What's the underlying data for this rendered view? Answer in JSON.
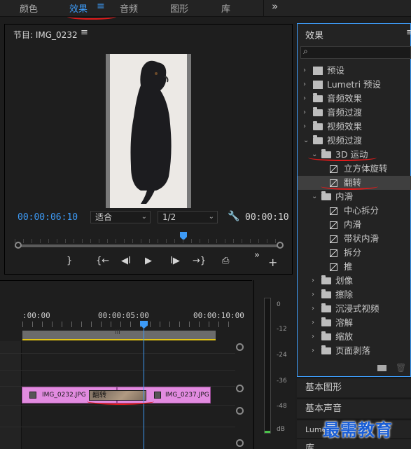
{
  "workspaces": {
    "tabs": [
      "颜色",
      "效果",
      "音频",
      "图形",
      "库"
    ],
    "active": "效果",
    "more_label": "»"
  },
  "program": {
    "title": "节目: IMG_0232",
    "menu_label": "≡",
    "timecode_current": "00:00:06:10",
    "zoom_value": "适合",
    "resolution_value": "1/2",
    "timecode_duration": "00:00:10",
    "controls": {
      "mark_in": "{",
      "mark_out": "}",
      "go_in": "{←",
      "step_back": "◀I",
      "play": "▶",
      "step_forward": "I▶",
      "go_out": "→}",
      "export_frame": "⎙",
      "more": "»",
      "add": "+"
    }
  },
  "effects": {
    "title": "效果",
    "menu_label": "≡",
    "search_placeholder": "",
    "tree": [
      {
        "label": "预设",
        "type": "preset",
        "level": 0,
        "expanded": false
      },
      {
        "label": "Lumetri 预设",
        "type": "preset",
        "level": 0,
        "expanded": false
      },
      {
        "label": "音频效果",
        "type": "folder",
        "level": 0,
        "expanded": false
      },
      {
        "label": "音频过渡",
        "type": "folder",
        "level": 0,
        "expanded": false
      },
      {
        "label": "视频效果",
        "type": "folder",
        "level": 0,
        "expanded": false
      },
      {
        "label": "视频过渡",
        "type": "folder",
        "level": 0,
        "expanded": true
      },
      {
        "label": "3D 运动",
        "type": "folder",
        "level": 1,
        "expanded": true
      },
      {
        "label": "立方体旋转",
        "type": "effect",
        "level": 2
      },
      {
        "label": "翻转",
        "type": "effect",
        "level": 2,
        "selected": true
      },
      {
        "label": "内滑",
        "type": "folder",
        "level": 1,
        "expanded": true
      },
      {
        "label": "中心拆分",
        "type": "effect",
        "level": 2
      },
      {
        "label": "内滑",
        "type": "effect",
        "level": 2
      },
      {
        "label": "带状内滑",
        "type": "effect",
        "level": 2
      },
      {
        "label": "拆分",
        "type": "effect",
        "level": 2
      },
      {
        "label": "推",
        "type": "effect",
        "level": 2
      },
      {
        "label": "划像",
        "type": "folder",
        "level": 1,
        "expanded": false
      },
      {
        "label": "擦除",
        "type": "folder",
        "level": 1,
        "expanded": false
      },
      {
        "label": "沉浸式视频",
        "type": "folder",
        "level": 1,
        "expanded": false
      },
      {
        "label": "溶解",
        "type": "folder",
        "level": 1,
        "expanded": false
      },
      {
        "label": "缩放",
        "type": "folder",
        "level": 1,
        "expanded": false
      },
      {
        "label": "页面剥落",
        "type": "folder",
        "level": 1,
        "expanded": false
      }
    ]
  },
  "panels": {
    "essential_graphics": "基本图形",
    "essential_sound": "基本声音",
    "lumetri": "Lumetri",
    "library": "库"
  },
  "timeline": {
    "ruler_labels": [
      ":00:00",
      "00:00:05:00",
      "00:00:10:00"
    ],
    "clip_a": "IMG_0232.JPG",
    "clip_b": "IMG_0237.JPG",
    "transition_label": "翻转"
  },
  "meter": {
    "db_labels": [
      "0",
      "-12",
      "-24",
      "-36",
      "-48",
      "dB"
    ]
  },
  "watermark": "最需教育",
  "colors": {
    "accent": "#3d9af5",
    "annotation": "#e01b1b",
    "clip": "#e28be0",
    "work_area": "#e3c416"
  }
}
